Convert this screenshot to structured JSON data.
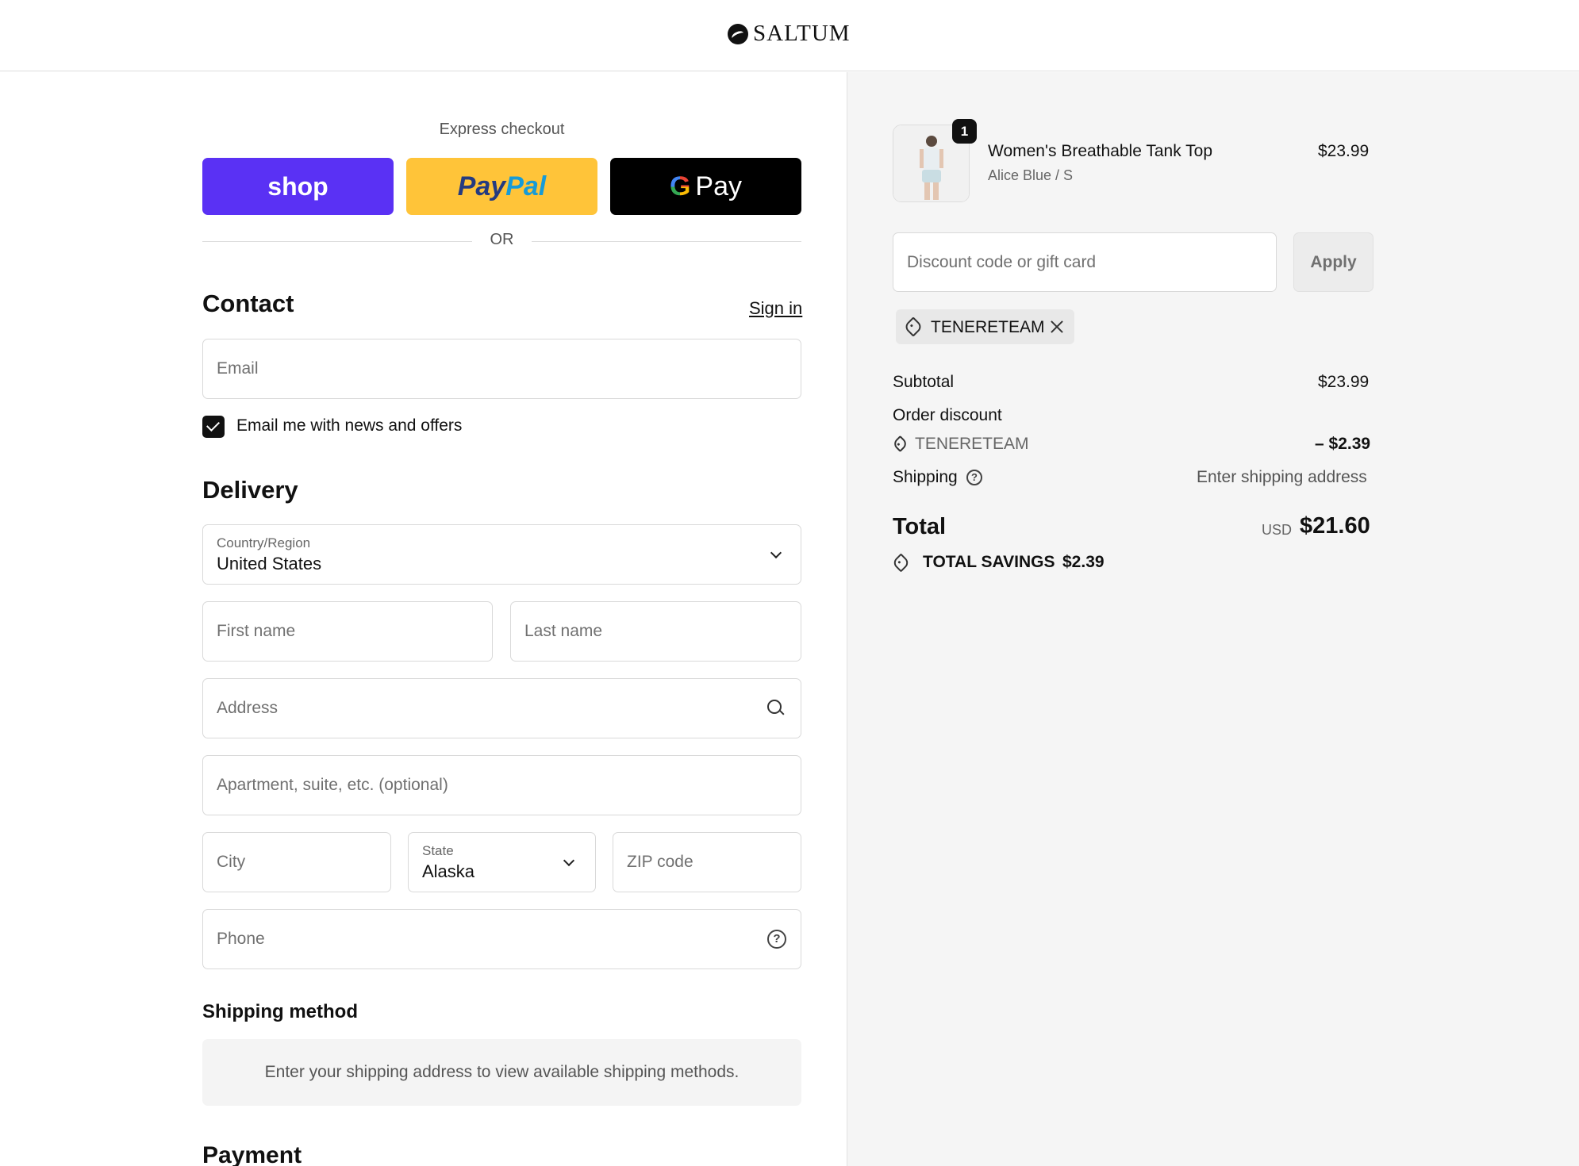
{
  "header": {
    "brand": "SALTUM"
  },
  "express": {
    "title": "Express checkout",
    "shop_label": "shop",
    "paypal_part1": "Pay",
    "paypal_part2": "Pal",
    "gpay_g": "G",
    "gpay_label": "Pay",
    "or": "OR"
  },
  "contact": {
    "title": "Contact",
    "sign_in": "Sign in",
    "email_placeholder": "Email",
    "news_label": "Email me with news and offers",
    "news_checked": true
  },
  "delivery": {
    "title": "Delivery",
    "country_label": "Country/Region",
    "country_value": "United States",
    "first_name_placeholder": "First name",
    "last_name_placeholder": "Last name",
    "address_placeholder": "Address",
    "apartment_placeholder": "Apartment, suite, etc. (optional)",
    "city_placeholder": "City",
    "state_label": "State",
    "state_value": "Alaska",
    "zip_placeholder": "ZIP code",
    "phone_placeholder": "Phone"
  },
  "shipping_method": {
    "title": "Shipping method",
    "message": "Enter your shipping address to view available shipping methods."
  },
  "payment": {
    "title": "Payment"
  },
  "summary": {
    "item": {
      "quantity": "1",
      "name": "Women's Breathable Tank Top",
      "variant": "Alice Blue / S",
      "price": "$23.99"
    },
    "discount_placeholder": "Discount code or gift card",
    "apply_label": "Apply",
    "applied_code": "TENERETEAM",
    "subtotal_label": "Subtotal",
    "subtotal_value": "$23.99",
    "order_discount_label": "Order discount",
    "discount_code": "TENERETEAM",
    "discount_value": "– $2.39",
    "shipping_label": "Shipping",
    "shipping_value": "Enter shipping address",
    "total_label": "Total",
    "currency": "USD",
    "total_value": "$21.60",
    "savings_label": "TOTAL SAVINGS",
    "savings_value": "$2.39"
  }
}
